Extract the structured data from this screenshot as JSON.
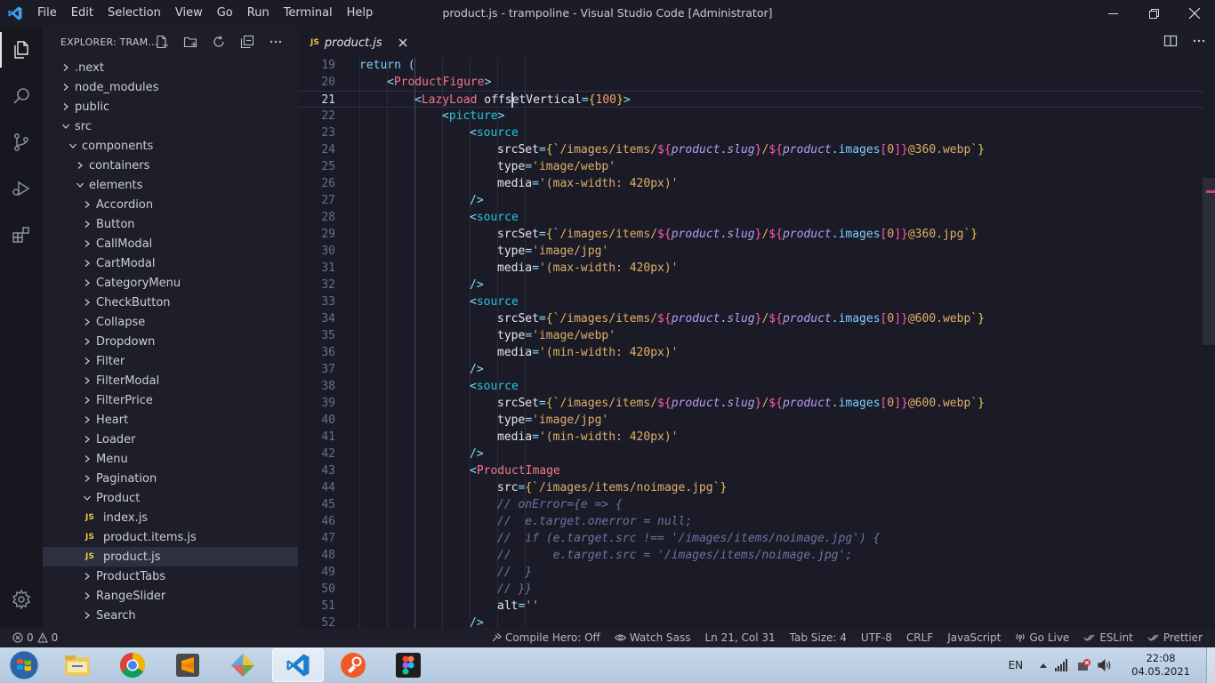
{
  "titlebar": {
    "menu": [
      "File",
      "Edit",
      "Selection",
      "View",
      "Go",
      "Run",
      "Terminal",
      "Help"
    ],
    "window_title": "product.js - trampoline - Visual Studio Code [Administrator]"
  },
  "activity_bar": {
    "items": [
      "explorer-icon",
      "search-icon",
      "source-control-icon",
      "run-debug-icon",
      "extensions-icon"
    ],
    "bottom": "settings-gear-icon"
  },
  "sidebar": {
    "title": "EXPLORER: TRAM...",
    "actions": [
      "new-file-icon",
      "new-folder-icon",
      "refresh-icon",
      "collapse-all-icon",
      "more-icon"
    ],
    "tree": [
      {
        "label": ".next",
        "depth": 0,
        "type": "folder",
        "expanded": false
      },
      {
        "label": "node_modules",
        "depth": 0,
        "type": "folder",
        "expanded": false
      },
      {
        "label": "public",
        "depth": 0,
        "type": "folder",
        "expanded": false
      },
      {
        "label": "src",
        "depth": 0,
        "type": "folder",
        "expanded": true
      },
      {
        "label": "components",
        "depth": 1,
        "type": "folder",
        "expanded": true
      },
      {
        "label": "containers",
        "depth": 2,
        "type": "folder",
        "expanded": false
      },
      {
        "label": "elements",
        "depth": 2,
        "type": "folder",
        "expanded": true
      },
      {
        "label": "Accordion",
        "depth": 3,
        "type": "folder",
        "expanded": false
      },
      {
        "label": "Button",
        "depth": 3,
        "type": "folder",
        "expanded": false
      },
      {
        "label": "CallModal",
        "depth": 3,
        "type": "folder",
        "expanded": false
      },
      {
        "label": "CartModal",
        "depth": 3,
        "type": "folder",
        "expanded": false
      },
      {
        "label": "CategoryMenu",
        "depth": 3,
        "type": "folder",
        "expanded": false
      },
      {
        "label": "CheckButton",
        "depth": 3,
        "type": "folder",
        "expanded": false
      },
      {
        "label": "Collapse",
        "depth": 3,
        "type": "folder",
        "expanded": false
      },
      {
        "label": "Dropdown",
        "depth": 3,
        "type": "folder",
        "expanded": false
      },
      {
        "label": "Filter",
        "depth": 3,
        "type": "folder",
        "expanded": false
      },
      {
        "label": "FilterModal",
        "depth": 3,
        "type": "folder",
        "expanded": false
      },
      {
        "label": "FilterPrice",
        "depth": 3,
        "type": "folder",
        "expanded": false
      },
      {
        "label": "Heart",
        "depth": 3,
        "type": "folder",
        "expanded": false
      },
      {
        "label": "Loader",
        "depth": 3,
        "type": "folder",
        "expanded": false
      },
      {
        "label": "Menu",
        "depth": 3,
        "type": "folder",
        "expanded": false
      },
      {
        "label": "Pagination",
        "depth": 3,
        "type": "folder",
        "expanded": false
      },
      {
        "label": "Product",
        "depth": 3,
        "type": "folder",
        "expanded": true
      },
      {
        "label": "index.js",
        "depth": 4,
        "type": "js",
        "expanded": false
      },
      {
        "label": "product.items.js",
        "depth": 4,
        "type": "js",
        "expanded": false
      },
      {
        "label": "product.js",
        "depth": 4,
        "type": "js",
        "expanded": false,
        "selected": true
      },
      {
        "label": "ProductTabs",
        "depth": 3,
        "type": "folder",
        "expanded": false
      },
      {
        "label": "RangeSlider",
        "depth": 3,
        "type": "folder",
        "expanded": false
      },
      {
        "label": "Search",
        "depth": 3,
        "type": "folder",
        "expanded": false
      }
    ]
  },
  "editor": {
    "tab": {
      "badge": "JS",
      "label": "product.js"
    },
    "actions": [
      "split-editor-icon",
      "more-icon"
    ],
    "current_line": 21,
    "lines": [
      {
        "n": 19,
        "indent": 2,
        "tokens": [
          [
            "kw",
            "return "
          ],
          [
            "pun",
            "("
          ]
        ]
      },
      {
        "n": 20,
        "indent": 3,
        "tokens": [
          [
            "pun",
            "<"
          ],
          [
            "comp",
            "ProductFigure"
          ],
          [
            "pun",
            ">"
          ]
        ]
      },
      {
        "n": 21,
        "indent": 4,
        "tokens": [
          [
            "pun",
            "<"
          ],
          [
            "comp",
            "LazyLoad "
          ],
          [
            "white",
            "offs"
          ],
          [
            "cursor",
            ""
          ],
          [
            "white",
            "etVertical"
          ],
          [
            "pun",
            "="
          ],
          [
            "yl",
            "{"
          ],
          [
            "num",
            "100"
          ],
          [
            "yl",
            "}"
          ],
          [
            "pun",
            ">"
          ]
        ]
      },
      {
        "n": 22,
        "indent": 5,
        "tokens": [
          [
            "pun",
            "<"
          ],
          [
            "sky",
            "picture"
          ],
          [
            "pun",
            ">"
          ]
        ]
      },
      {
        "n": 23,
        "indent": 6,
        "tokens": [
          [
            "pun",
            "<"
          ],
          [
            "sky",
            "source"
          ]
        ]
      },
      {
        "n": 24,
        "indent": 7,
        "tokens": [
          [
            "white",
            "srcSet"
          ],
          [
            "pun",
            "="
          ],
          [
            "yl",
            "{"
          ],
          [
            "str",
            "`/images/items/"
          ],
          [
            "pink",
            "${"
          ],
          [
            "var",
            "product"
          ],
          [
            "pun",
            "."
          ],
          [
            "var",
            "slug"
          ],
          [
            "pink",
            "}"
          ],
          [
            "str",
            "/"
          ],
          [
            "pink",
            "${"
          ],
          [
            "var",
            "product"
          ],
          [
            "pun",
            "."
          ],
          [
            "prop",
            "images"
          ],
          [
            "pink",
            "["
          ],
          [
            "num",
            "0"
          ],
          [
            "pink",
            "]"
          ],
          [
            "pink",
            "}"
          ],
          [
            "str",
            "@360.webp`"
          ],
          [
            "yl",
            "}"
          ]
        ]
      },
      {
        "n": 25,
        "indent": 7,
        "tokens": [
          [
            "white",
            "type"
          ],
          [
            "pun",
            "="
          ],
          [
            "str",
            "'image/webp'"
          ]
        ]
      },
      {
        "n": 26,
        "indent": 7,
        "tokens": [
          [
            "white",
            "media"
          ],
          [
            "pun",
            "="
          ],
          [
            "str",
            "'(max-width: 420px)'"
          ]
        ]
      },
      {
        "n": 27,
        "indent": 6,
        "tokens": [
          [
            "pun",
            "/>"
          ]
        ]
      },
      {
        "n": 28,
        "indent": 6,
        "tokens": [
          [
            "pun",
            "<"
          ],
          [
            "sky",
            "source"
          ]
        ]
      },
      {
        "n": 29,
        "indent": 7,
        "tokens": [
          [
            "white",
            "srcSet"
          ],
          [
            "pun",
            "="
          ],
          [
            "yl",
            "{"
          ],
          [
            "str",
            "`/images/items/"
          ],
          [
            "pink",
            "${"
          ],
          [
            "var",
            "product"
          ],
          [
            "pun",
            "."
          ],
          [
            "var",
            "slug"
          ],
          [
            "pink",
            "}"
          ],
          [
            "str",
            "/"
          ],
          [
            "pink",
            "${"
          ],
          [
            "var",
            "product"
          ],
          [
            "pun",
            "."
          ],
          [
            "prop",
            "images"
          ],
          [
            "pink",
            "["
          ],
          [
            "num",
            "0"
          ],
          [
            "pink",
            "]"
          ],
          [
            "pink",
            "}"
          ],
          [
            "str",
            "@360.jpg`"
          ],
          [
            "yl",
            "}"
          ]
        ]
      },
      {
        "n": 30,
        "indent": 7,
        "tokens": [
          [
            "white",
            "type"
          ],
          [
            "pun",
            "="
          ],
          [
            "str",
            "'image/jpg'"
          ]
        ]
      },
      {
        "n": 31,
        "indent": 7,
        "tokens": [
          [
            "white",
            "media"
          ],
          [
            "pun",
            "="
          ],
          [
            "str",
            "'(max-width: 420px)'"
          ]
        ]
      },
      {
        "n": 32,
        "indent": 6,
        "tokens": [
          [
            "pun",
            "/>"
          ]
        ]
      },
      {
        "n": 33,
        "indent": 6,
        "tokens": [
          [
            "pun",
            "<"
          ],
          [
            "sky",
            "source"
          ]
        ]
      },
      {
        "n": 34,
        "indent": 7,
        "tokens": [
          [
            "white",
            "srcSet"
          ],
          [
            "pun",
            "="
          ],
          [
            "yl",
            "{"
          ],
          [
            "str",
            "`/images/items/"
          ],
          [
            "pink",
            "${"
          ],
          [
            "var",
            "product"
          ],
          [
            "pun",
            "."
          ],
          [
            "var",
            "slug"
          ],
          [
            "pink",
            "}"
          ],
          [
            "str",
            "/"
          ],
          [
            "pink",
            "${"
          ],
          [
            "var",
            "product"
          ],
          [
            "pun",
            "."
          ],
          [
            "prop",
            "images"
          ],
          [
            "pink",
            "["
          ],
          [
            "num",
            "0"
          ],
          [
            "pink",
            "]"
          ],
          [
            "pink",
            "}"
          ],
          [
            "str",
            "@600.webp`"
          ],
          [
            "yl",
            "}"
          ]
        ]
      },
      {
        "n": 35,
        "indent": 7,
        "tokens": [
          [
            "white",
            "type"
          ],
          [
            "pun",
            "="
          ],
          [
            "str",
            "'image/webp'"
          ]
        ]
      },
      {
        "n": 36,
        "indent": 7,
        "tokens": [
          [
            "white",
            "media"
          ],
          [
            "pun",
            "="
          ],
          [
            "str",
            "'(min-width: 420px)'"
          ]
        ]
      },
      {
        "n": 37,
        "indent": 6,
        "tokens": [
          [
            "pun",
            "/>"
          ]
        ]
      },
      {
        "n": 38,
        "indent": 6,
        "tokens": [
          [
            "pun",
            "<"
          ],
          [
            "sky",
            "source"
          ]
        ]
      },
      {
        "n": 39,
        "indent": 7,
        "tokens": [
          [
            "white",
            "srcSet"
          ],
          [
            "pun",
            "="
          ],
          [
            "yl",
            "{"
          ],
          [
            "str",
            "`/images/items/"
          ],
          [
            "pink",
            "${"
          ],
          [
            "var",
            "product"
          ],
          [
            "pun",
            "."
          ],
          [
            "var",
            "slug"
          ],
          [
            "pink",
            "}"
          ],
          [
            "str",
            "/"
          ],
          [
            "pink",
            "${"
          ],
          [
            "var",
            "product"
          ],
          [
            "pun",
            "."
          ],
          [
            "prop",
            "images"
          ],
          [
            "pink",
            "["
          ],
          [
            "num",
            "0"
          ],
          [
            "pink",
            "]"
          ],
          [
            "pink",
            "}"
          ],
          [
            "str",
            "@600.webp`"
          ],
          [
            "yl",
            "}"
          ]
        ]
      },
      {
        "n": 40,
        "indent": 7,
        "tokens": [
          [
            "white",
            "type"
          ],
          [
            "pun",
            "="
          ],
          [
            "str",
            "'image/jpg'"
          ]
        ]
      },
      {
        "n": 41,
        "indent": 7,
        "tokens": [
          [
            "white",
            "media"
          ],
          [
            "pun",
            "="
          ],
          [
            "str",
            "'(min-width: 420px)'"
          ]
        ]
      },
      {
        "n": 42,
        "indent": 6,
        "tokens": [
          [
            "pun",
            "/>"
          ]
        ]
      },
      {
        "n": 43,
        "indent": 6,
        "tokens": [
          [
            "pun",
            "<"
          ],
          [
            "comp",
            "ProductImage"
          ]
        ]
      },
      {
        "n": 44,
        "indent": 7,
        "tokens": [
          [
            "white",
            "src"
          ],
          [
            "pun",
            "="
          ],
          [
            "yl",
            "{"
          ],
          [
            "str",
            "`/images/items/noimage.jpg`"
          ],
          [
            "yl",
            "}"
          ]
        ]
      },
      {
        "n": 45,
        "indent": 7,
        "tokens": [
          [
            "com",
            "// onError={e => {"
          ]
        ]
      },
      {
        "n": 46,
        "indent": 7,
        "tokens": [
          [
            "com",
            "//  e.target.onerror = null;"
          ]
        ]
      },
      {
        "n": 47,
        "indent": 7,
        "tokens": [
          [
            "com",
            "//  if (e.target.src !== '/images/items/noimage.jpg') {"
          ]
        ]
      },
      {
        "n": 48,
        "indent": 7,
        "tokens": [
          [
            "com",
            "//      e.target.src = '/images/items/noimage.jpg';"
          ]
        ]
      },
      {
        "n": 49,
        "indent": 7,
        "tokens": [
          [
            "com",
            "//  }"
          ]
        ]
      },
      {
        "n": 50,
        "indent": 7,
        "tokens": [
          [
            "com",
            "// }}"
          ]
        ]
      },
      {
        "n": 51,
        "indent": 7,
        "tokens": [
          [
            "white",
            "alt"
          ],
          [
            "pun",
            "="
          ],
          [
            "str",
            "''"
          ]
        ]
      },
      {
        "n": 52,
        "indent": 6,
        "tokens": [
          [
            "pun",
            "/>"
          ]
        ]
      }
    ]
  },
  "statusbar": {
    "errors": "0",
    "warnings": "0",
    "items": [
      {
        "icon": "compile-hero-icon",
        "text": "Compile Hero: Off"
      },
      {
        "icon": "eye-icon",
        "text": "Watch Sass"
      },
      {
        "icon": "",
        "text": "Ln 21, Col 31"
      },
      {
        "icon": "",
        "text": "Tab Size: 4"
      },
      {
        "icon": "",
        "text": "UTF-8"
      },
      {
        "icon": "",
        "text": "CRLF"
      },
      {
        "icon": "",
        "text": "JavaScript"
      },
      {
        "icon": "broadcast-icon",
        "text": "Go Live"
      },
      {
        "icon": "double-check-icon",
        "text": "ESLint"
      },
      {
        "icon": "double-check-icon",
        "text": "Prettier"
      }
    ]
  },
  "taskbar": {
    "apps": [
      "file-explorer",
      "chrome",
      "sublime-text",
      "sourcetree",
      "vscode",
      "postman",
      "figma"
    ],
    "active_app": "vscode",
    "language": "EN",
    "time": "22:08",
    "date": "04.05.2021"
  },
  "colors": {
    "editor_bg": "#1a1b26",
    "sidebar_bg": "#1d1e29",
    "taskbar": "#b9cde3"
  }
}
